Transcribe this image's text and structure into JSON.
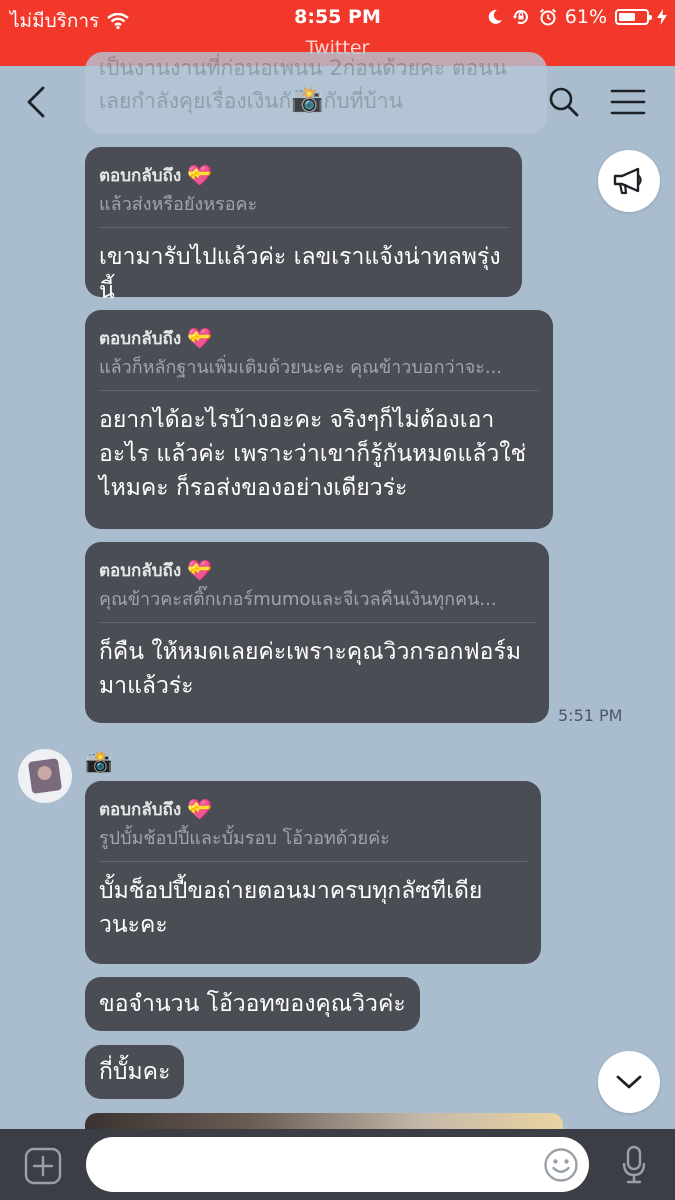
{
  "status_bar": {
    "carrier": "ไม่มีบริการ",
    "time": "8:55 PM",
    "battery_percent": "61%",
    "battery_level": 0.61,
    "source_app": "Twitter"
  },
  "header": {
    "back_icon": "chevron-left-icon",
    "search_icon": "search-icon",
    "menu_icon": "hamburger-menu-icon"
  },
  "ghost_message": {
    "line1": "เป็นงานงานที่ก่อนอเพนน 2ก่อนด้วยคะ ตอนน",
    "line2_start": "เลยกำลังคุยเรื่องเงินกั",
    "camera": "📸",
    "line2_end": "กับที่บ้าน"
  },
  "messages": [
    {
      "reply_label": "ตอบกลับถึง",
      "reply_emoji": "💝",
      "quote": "แล้วส่งหรือยังหรอคะ",
      "text": "เขามารับไปแล้วค่ะ เลขเราแจ้งน่าทลพรุ่งนี้"
    },
    {
      "reply_label": "ตอบกลับถึง",
      "reply_emoji": "💝",
      "quote": "แล้วก็หลักฐานเพิ่มเติมด้วยนะคะ คุณข้าวบอกว่าจะ...",
      "text": "อยากได้อะไรบ้างอะคะ จริงๆก็ไม่ต้องเอาอะไร แล้วค่ะ เพราะว่าเขาก็รู้กันหมดแล้วใช่ไหมคะ ก็รอส่งของอย่างเดียวร่ะ"
    },
    {
      "reply_label": "ตอบกลับถึง",
      "reply_emoji": "💝",
      "quote": "คุณข้าวคะสติ๊กเกอร์mumoและจีเวลคืนเงินทุกคน...",
      "text": "ก็คืน ให้หมดเลยค่ะเพราะคุณวิวกรอกฟอร์ม มาแล้วร่ะ",
      "time": "5:51 PM"
    }
  ],
  "sender": {
    "name": "📸"
  },
  "incoming": {
    "reply_label": "ตอบกลับถึง",
    "reply_emoji": "💝",
    "quote": "รูปบั้มช้อปปี้และบั้มรอบ โอ้วอทด้วยค่ะ",
    "text": "บั้มช็อปปี้ขอถ่ายตอนมาครบทุกลัซทีเดีย วนะคะ",
    "short1": "ขอจำนวน โอ้วอทของคุณวิวค่ะ",
    "short2": "กี่บั้มคะ"
  },
  "input": {
    "value": "",
    "placeholder": ""
  },
  "icons": {
    "announce": "megaphone-icon",
    "scroll_down": "chevron-down-icon",
    "add": "plus-icon",
    "emoji": "emoji-icon",
    "mic": "microphone-icon"
  },
  "colors": {
    "status_bar": "#f2382a",
    "chat_background": "#a9bdcf",
    "bubble": "#4a4d53",
    "input_bar": "#3b3f45"
  }
}
